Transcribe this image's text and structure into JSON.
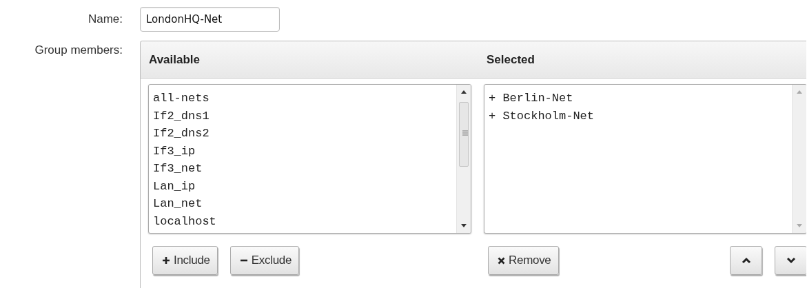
{
  "name_field": {
    "label": "Name:",
    "value": "LondonHQ-Net"
  },
  "group_members": {
    "label": "Group members:",
    "available": {
      "heading": "Available",
      "items": [
        "all-nets",
        "If2_dns1",
        "If2_dns2",
        "If3_ip",
        "If3_net",
        "Lan_ip",
        "Lan_net",
        "localhost"
      ]
    },
    "selected": {
      "heading": "Selected",
      "items": [
        "+ Berlin-Net",
        "+ Stockholm-Net"
      ]
    },
    "buttons": [
      {
        "kind": "include",
        "label": "Include"
      },
      {
        "kind": "exclude",
        "label": "Exclude"
      },
      {
        "kind": "remove",
        "label": "Remove"
      },
      {
        "kind": "up"
      },
      {
        "kind": "down"
      }
    ]
  }
}
